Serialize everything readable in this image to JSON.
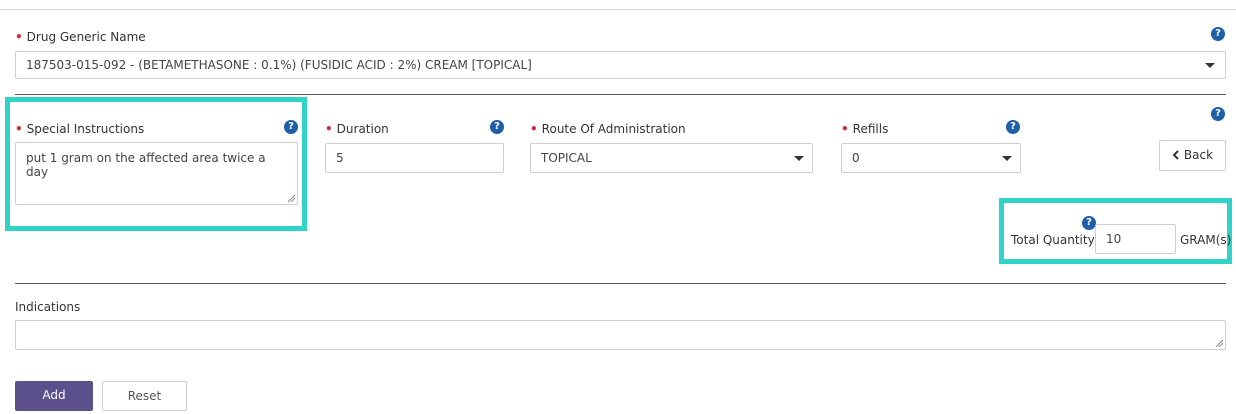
{
  "drug": {
    "label": "Drug Generic Name",
    "value": "187503-015-092 - (BETAMETHASONE : 0.1%) (FUSIDIC ACID : 2%) CREAM [TOPICAL]"
  },
  "special_instructions": {
    "label": "Special Instructions",
    "value": "put 1 gram on the affected area twice a day"
  },
  "duration": {
    "label": "Duration",
    "value": "5"
  },
  "route": {
    "label": "Route Of Administration",
    "value": "TOPICAL"
  },
  "refills": {
    "label": "Refills",
    "value": "0"
  },
  "back_button": {
    "icon": "chevron-left-icon",
    "label": "Back"
  },
  "total_quantity": {
    "label": "Total Quantity:",
    "value": "10",
    "unit": "GRAM(s)"
  },
  "indications": {
    "label": "Indications",
    "value": ""
  },
  "buttons": {
    "add": "Add",
    "reset": "Reset"
  },
  "help_glyph": "?",
  "required_mark": "•",
  "colors": {
    "required": "#d9283a",
    "help": "#1f5fa8",
    "highlight": "#2fd3c8",
    "add_button": "#5b4f8c"
  }
}
